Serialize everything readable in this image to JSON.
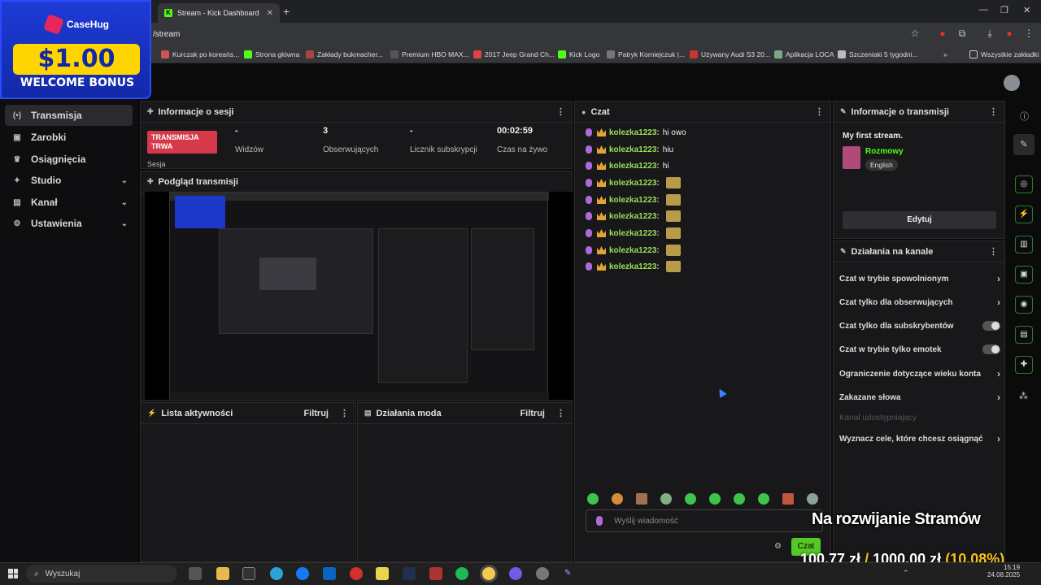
{
  "browser": {
    "tab_title": "Stream - Kick Dashboard",
    "tab_favicon": "K",
    "url": "/stream",
    "bookmarks": [
      "Kurczak po koreańs...",
      "Strona główna",
      "Zakłady bukmacher...",
      "Premium HBO MAX...",
      "2017 Jeep Grand Ch...",
      "Kick Logo",
      "Patryk Korniejczuk |...",
      "Używany Audi S3 20...",
      "Aplikacja LOCA",
      "Szczeniaki 5 tygodni..."
    ],
    "bookmarks_more": "Wszystkie zakładki"
  },
  "ad": {
    "brand": "CaseHug",
    "amount": "$1.00",
    "text": "WELCOME BONUS"
  },
  "sidebar": {
    "items": [
      {
        "label": "Transmisja",
        "icon": "broadcast-icon"
      },
      {
        "label": "Zarobki",
        "icon": "wallet-icon"
      },
      {
        "label": "Osiągnięcia",
        "icon": "trophy-icon"
      },
      {
        "label": "Studio",
        "icon": "studio-icon"
      },
      {
        "label": "Kanał",
        "icon": "channel-icon"
      },
      {
        "label": "Ustawienia",
        "icon": "gear-icon"
      }
    ]
  },
  "session": {
    "title": "Informacje o sesji",
    "live_badge": "TRANSMISJA TRWA",
    "sesja": "Sesja",
    "viewers_value": "-",
    "viewers_label": "Widzów",
    "followers_value": "3",
    "followers_label": "Obserwujących",
    "subs_value": "-",
    "subs_label": "Licznik subskrypcji",
    "time_value": "00:02:59",
    "time_label": "Czas na żywo"
  },
  "preview": {
    "title": "Podgląd transmisji"
  },
  "activity": {
    "title": "Lista aktywności",
    "filter": "Filtruj"
  },
  "modactions": {
    "title": "Działania moda",
    "filter": "Filtruj"
  },
  "chat": {
    "title": "Czat",
    "messages": [
      {
        "user": "kolezka1223:",
        "text": "hi owo"
      },
      {
        "user": "kolezka1223:",
        "text": "hiu"
      },
      {
        "user": "kolezka1223:",
        "text": "hi"
      },
      {
        "user": "kolezka1223:",
        "text": ""
      },
      {
        "user": "kolezka1223:",
        "text": ""
      },
      {
        "user": "kolezka1223:",
        "text": ""
      },
      {
        "user": "kolezka1223:",
        "text": ""
      },
      {
        "user": "kolezka1223:",
        "text": ""
      },
      {
        "user": "kolezka1223:",
        "text": ""
      }
    ],
    "placeholder": "Wyślij wiadomość",
    "send": "Czat"
  },
  "stream_info": {
    "title": "Informacje o transmisji",
    "stream_title": "My first stream.",
    "category": "Rozmowy",
    "language": "English",
    "edit": "Edytuj"
  },
  "channel_actions": {
    "title": "Działania na kanale",
    "items": [
      {
        "label": "Czat w trybie spowolnionym",
        "kind": "arrow"
      },
      {
        "label": "Czat tylko dla obserwujących",
        "kind": "arrow"
      },
      {
        "label": "Czat tylko dla subskrybentów",
        "kind": "toggle"
      },
      {
        "label": "Czat w trybie tylko emotek",
        "kind": "toggle"
      },
      {
        "label": "Ograniczenie dotyczące wieku konta",
        "kind": "arrow"
      },
      {
        "label": "Zakazane słowa",
        "kind": "arrow"
      },
      {
        "label": "Kanał udostępniający",
        "kind": "disabled"
      },
      {
        "label": "Wyznacz cele, które chcesz osiągnąć",
        "kind": "arrow"
      }
    ]
  },
  "overlay": {
    "goal_title": "Na rozwijanie Stramów",
    "current": "100,77 zł",
    "separator": "/",
    "target": "1000,00 zł",
    "percent": "(10.08%)"
  },
  "taskbar": {
    "search": "Wyszukaj",
    "time": "15:19",
    "date": "24.08.2025"
  }
}
